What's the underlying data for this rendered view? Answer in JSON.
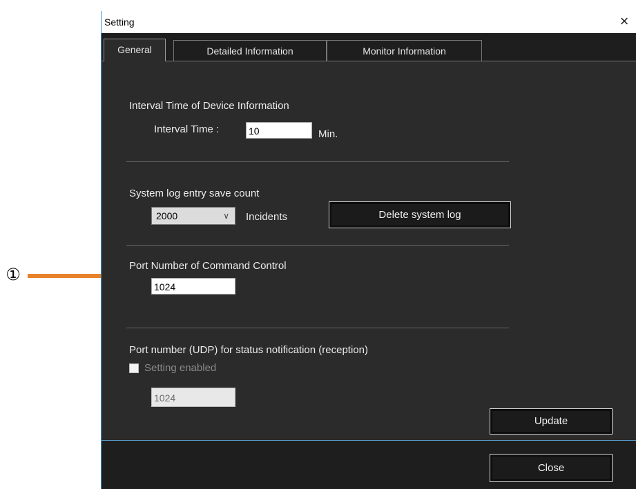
{
  "callout": {
    "number": "①"
  },
  "window": {
    "title": "Setting",
    "close_icon": "×"
  },
  "tabs": [
    {
      "label": "General",
      "active": true
    },
    {
      "label": "Detailed Information",
      "active": false
    },
    {
      "label": "Monitor Information",
      "active": false
    }
  ],
  "general": {
    "interval": {
      "heading": "Interval Time of Device Information",
      "field_label": "Interval Time :",
      "value": "10",
      "unit": "Min."
    },
    "syslog": {
      "heading": "System log entry save count",
      "selected": "2000",
      "unit": "Incidents",
      "delete_button": "Delete system log"
    },
    "command_port": {
      "heading": "Port Number of Command Control",
      "value": "1024"
    },
    "udp_port": {
      "heading": "Port number (UDP) for status notification (reception)",
      "checkbox_label": "Setting enabled",
      "checked": false,
      "value": "1024"
    },
    "update_button": "Update"
  },
  "footer": {
    "close_button": "Close"
  },
  "colors": {
    "callout_line": "#e8822a",
    "window_bg": "#2b2b2b",
    "window_border": "#3c8fd0"
  }
}
